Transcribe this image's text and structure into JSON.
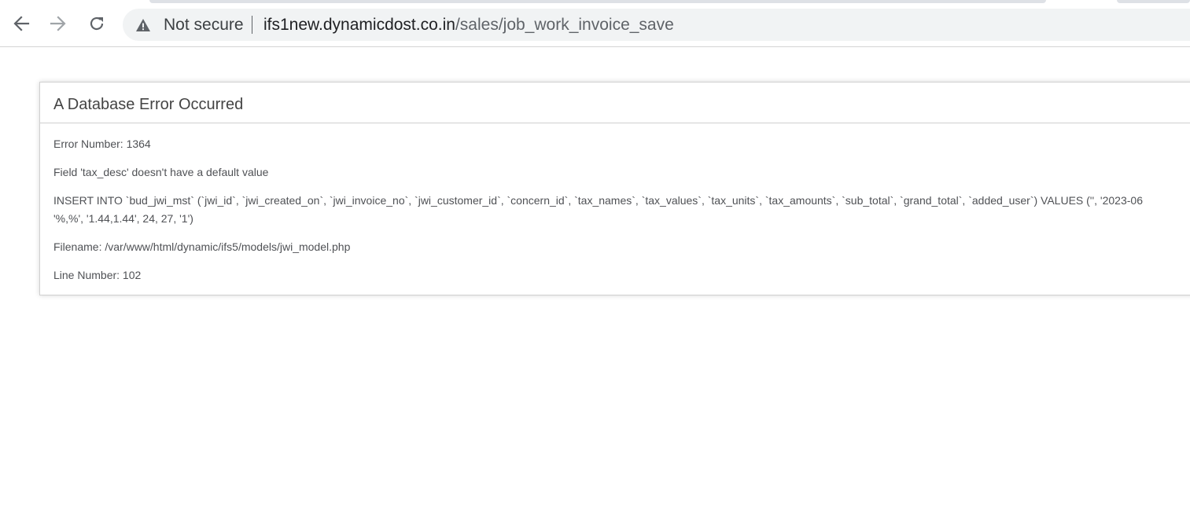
{
  "browser": {
    "nav": {
      "back_icon": "arrow-left-icon",
      "forward_icon": "arrow-right-icon",
      "reload_icon": "reload-icon"
    },
    "omnibox": {
      "security_icon": "warning-triangle-icon",
      "security_label": "Not secure",
      "url_host": "ifs1new.dynamicdost.co.in",
      "url_path": "/sales/job_work_invoice_save"
    }
  },
  "error": {
    "title": "A Database Error Occurred",
    "error_number": "Error Number: 1364",
    "message": "Field 'tax_desc' doesn't have a default value",
    "query_line1": "INSERT INTO `bud_jwi_mst` (`jwi_id`, `jwi_created_on`, `jwi_invoice_no`, `jwi_customer_id`, `concern_id`, `tax_names`, `tax_values`, `tax_units`, `tax_amounts`, `sub_total`, `grand_total`, `added_user`) VALUES ('', '2023-06",
    "query_line2": "'%,%', '1.44,1.44', 24, 27, '1')",
    "filename": "Filename: /var/www/html/dynamic/ifs5/models/jwi_model.php",
    "line_number": "Line Number: 102"
  },
  "colors": {
    "chrome_bg": "#ffffff",
    "omnibox_bg": "#f1f3f4",
    "icon_gray": "#5f6368",
    "disabled_gray": "#a0a4a8",
    "error_title": "#444444",
    "error_text": "#4f5155",
    "border": "#d0d0d0"
  }
}
